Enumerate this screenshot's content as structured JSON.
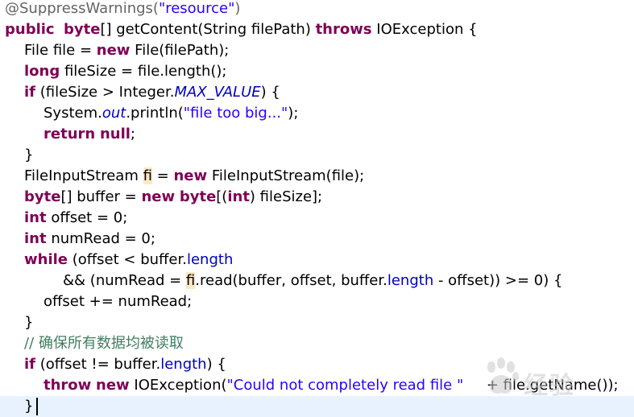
{
  "editor": {
    "lines": [
      {
        "indent": 0,
        "tokens": [
          [
            "ann",
            "@SuppressWarnings("
          ],
          [
            "str",
            "\"resource\""
          ],
          [
            "ann",
            ")"
          ]
        ]
      },
      {
        "indent": 0,
        "tokens": [
          [
            "kw",
            "public"
          ],
          [
            "",
            "  "
          ],
          [
            "kw",
            "byte"
          ],
          [
            "",
            "[] getContent(String filePath) "
          ],
          [
            "kw",
            "throws"
          ],
          [
            "",
            " IOException {"
          ]
        ]
      },
      {
        "indent": 1,
        "tokens": [
          [
            "",
            "File file = "
          ],
          [
            "kw",
            "new"
          ],
          [
            "",
            " File(filePath);"
          ]
        ]
      },
      {
        "indent": 1,
        "tokens": [
          [
            "kw",
            "long"
          ],
          [
            "",
            " fileSize = file.length();"
          ]
        ]
      },
      {
        "indent": 1,
        "tokens": [
          [
            "kw",
            "if"
          ],
          [
            "",
            " (fileSize > Integer."
          ],
          [
            "static",
            "MAX_VALUE"
          ],
          [
            "",
            ") {"
          ]
        ]
      },
      {
        "indent": 2,
        "tokens": [
          [
            "",
            "System."
          ],
          [
            "static",
            "out"
          ],
          [
            "",
            ".println("
          ],
          [
            "str",
            "\"file too big...\""
          ],
          [
            "",
            ");"
          ]
        ]
      },
      {
        "indent": 2,
        "tokens": [
          [
            "kw",
            "return"
          ],
          [
            "",
            " "
          ],
          [
            "kw",
            "null"
          ],
          [
            "",
            ";"
          ]
        ]
      },
      {
        "indent": 1,
        "tokens": [
          [
            "",
            "}"
          ]
        ]
      },
      {
        "indent": 1,
        "tokens": [
          [
            "",
            "FileInputStream "
          ],
          [
            "hl",
            "fi"
          ],
          [
            "",
            " = "
          ],
          [
            "kw",
            "new"
          ],
          [
            "",
            " FileInputStream(file);"
          ]
        ]
      },
      {
        "indent": 1,
        "tokens": [
          [
            "kw",
            "byte"
          ],
          [
            "",
            "[] buffer = "
          ],
          [
            "kw",
            "new"
          ],
          [
            "",
            " "
          ],
          [
            "kw",
            "byte"
          ],
          [
            "",
            "[("
          ],
          [
            "kw",
            "int"
          ],
          [
            "",
            ") fileSize];"
          ]
        ]
      },
      {
        "indent": 1,
        "tokens": [
          [
            "kw",
            "int"
          ],
          [
            "",
            " offset = 0;"
          ]
        ]
      },
      {
        "indent": 1,
        "tokens": [
          [
            "kw",
            "int"
          ],
          [
            "",
            " numRead = 0;"
          ]
        ]
      },
      {
        "indent": 1,
        "tokens": [
          [
            "kw",
            "while"
          ],
          [
            "",
            " (offset < buffer."
          ],
          [
            "field",
            "length"
          ]
        ]
      },
      {
        "indent": 3,
        "tokens": [
          [
            "",
            "&& (numRead = "
          ],
          [
            "hl",
            "fi"
          ],
          [
            "",
            ".read(buffer, offset, buffer."
          ],
          [
            "field",
            "length"
          ],
          [
            "",
            " - offset)) >= 0) {"
          ]
        ]
      },
      {
        "indent": 2,
        "tokens": [
          [
            "",
            "offset += numRead;"
          ]
        ]
      },
      {
        "indent": 1,
        "tokens": [
          [
            "",
            "}"
          ]
        ]
      },
      {
        "indent": 1,
        "tokens": [
          [
            "comment",
            "// 确保所有数据均被读取"
          ]
        ]
      },
      {
        "indent": 1,
        "tokens": [
          [
            "kw",
            "if"
          ],
          [
            "",
            " (offset != buffer."
          ],
          [
            "field",
            "length"
          ],
          [
            "",
            ") {"
          ]
        ]
      },
      {
        "indent": 2,
        "tokens": [
          [
            "kw",
            "throw"
          ],
          [
            "",
            " "
          ],
          [
            "kw",
            "new"
          ],
          [
            "",
            " IOException("
          ],
          [
            "str",
            "\"Could not completely read file \""
          ],
          [
            "",
            "     + file.getName());"
          ]
        ]
      },
      {
        "indent": 1,
        "tokens": [
          [
            "",
            "}"
          ]
        ],
        "caret": true
      }
    ]
  },
  "watermark": {
    "text": "经验"
  },
  "colors": {
    "keyword": "#7f0055",
    "string": "#2a00ff",
    "field": "#0000c0",
    "annotation": "#646464",
    "comment": "#3f7f5f",
    "occurrence_highlight": "#fce7c6",
    "current_line": "#e8f2fe"
  }
}
